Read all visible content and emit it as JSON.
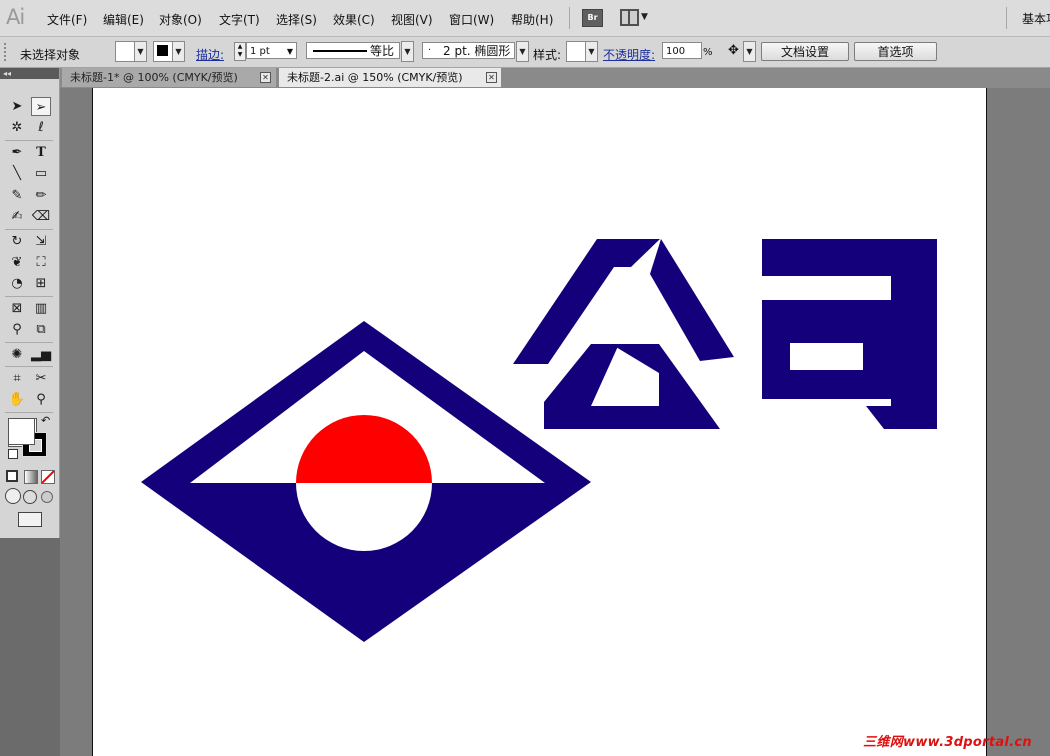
{
  "app": {
    "logo": "Ai",
    "workspace": "基本功"
  },
  "menu": [
    "文件(F)",
    "编辑(E)",
    "对象(O)",
    "文字(T)",
    "选择(S)",
    "效果(C)",
    "视图(V)",
    "窗口(W)",
    "帮助(H)"
  ],
  "bridge_label": "Br",
  "control": {
    "selection_status": "未选择对象",
    "stroke_link": "描边:",
    "stroke_weight": "1 pt",
    "stroke_profile": "等比",
    "brush_dot": "·",
    "brush": "2 pt. 椭圆形",
    "style_label": "样式:",
    "opacity_link": "不透明度:",
    "opacity_value": "100",
    "opacity_unit": "%",
    "doc_setup_button": "文档设置",
    "preferences_button": "首选项"
  },
  "tabs": [
    {
      "label": "未标题-1* @ 100% (CMYK/预览)",
      "active": false
    },
    {
      "label": "未标题-2.ai @ 150% (CMYK/预览)",
      "active": true
    }
  ],
  "toolbox_collapse": "◂◂",
  "artwork": {
    "text_company": "公司",
    "colors": {
      "navy": "#14007a",
      "red": "#ff0000",
      "white": "#ffffff"
    }
  },
  "watermark": "三维网www.3dportal.cn"
}
